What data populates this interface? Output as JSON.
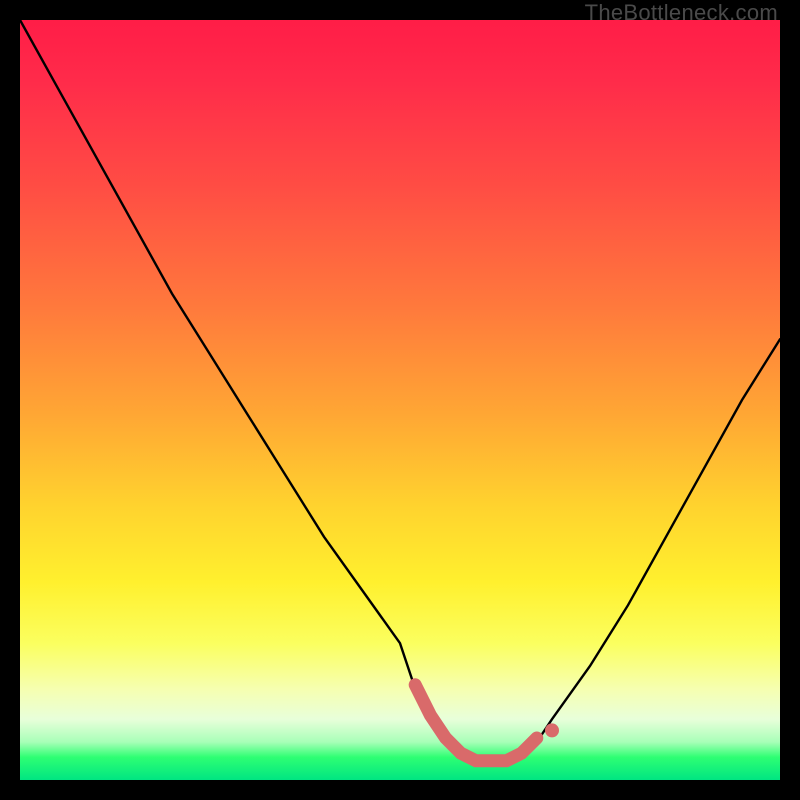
{
  "watermark": "TheBottleneck.com",
  "colors": {
    "frame": "#000000",
    "curve": "#000000",
    "accent": "#d96a6a",
    "gradient_top": "#ff1d47",
    "gradient_mid": "#ffd32e",
    "gradient_bottom": "#00e582"
  },
  "chart_data": {
    "type": "line",
    "title": "",
    "xlabel": "",
    "ylabel": "",
    "xlim": [
      0,
      100
    ],
    "ylim": [
      0,
      100
    ],
    "grid": false,
    "legend": "none",
    "series": [
      {
        "name": "bottleneck-curve",
        "x": [
          0,
          5,
          10,
          15,
          20,
          25,
          30,
          35,
          40,
          45,
          50,
          52,
          54,
          56,
          58,
          60,
          62,
          64,
          66,
          68,
          70,
          75,
          80,
          85,
          90,
          95,
          100
        ],
        "y": [
          100,
          91,
          82,
          73,
          64,
          56,
          48,
          40,
          32,
          25,
          18,
          12,
          8,
          5,
          3,
          2,
          2,
          2,
          3,
          5,
          8,
          15,
          23,
          32,
          41,
          50,
          58
        ]
      }
    ],
    "annotations": [
      {
        "name": "optimal-range-highlight",
        "type": "segment",
        "x_start": 52,
        "x_end": 68,
        "y": 2,
        "color": "#d96a6a"
      },
      {
        "name": "optimal-end-marker",
        "type": "point",
        "x": 70,
        "y": 6,
        "color": "#d96a6a"
      }
    ]
  }
}
